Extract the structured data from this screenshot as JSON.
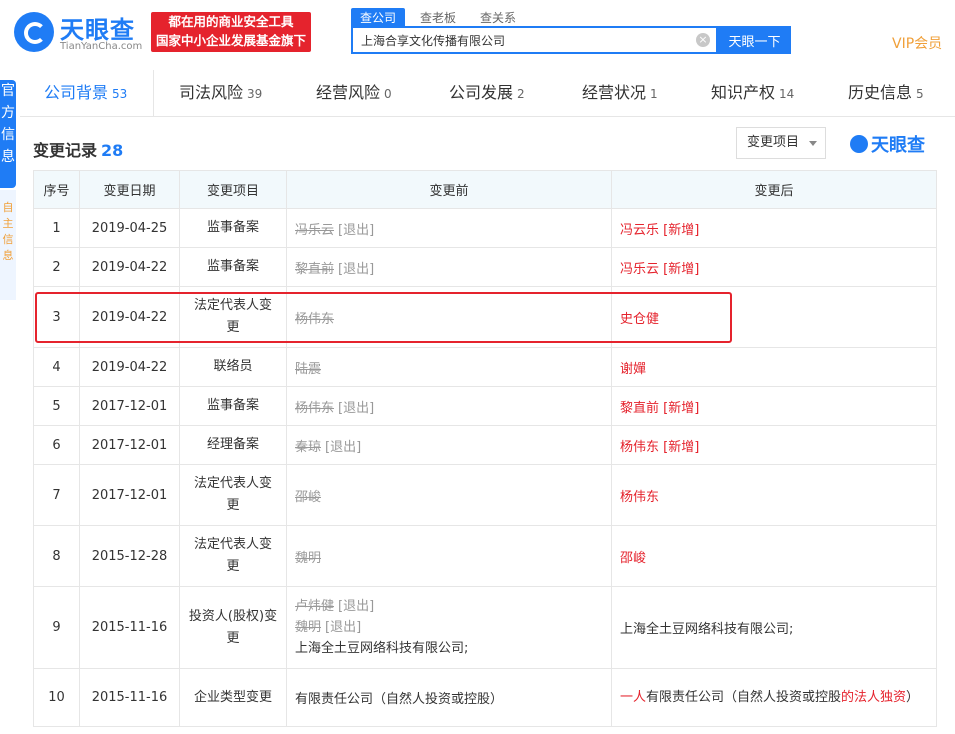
{
  "header": {
    "logo_cn": "天眼查",
    "logo_en": "TianYanCha.com",
    "slogan_line1": "都在用的商业安全工具",
    "slogan_line2": "国家中小企业发展基金旗下",
    "search_tabs": [
      "查公司",
      "查老板",
      "查关系"
    ],
    "search_value": "上海合享文化传播有限公司",
    "search_button": "天眼一下",
    "vip": "VIP会员"
  },
  "left_strip": {
    "blue_text": "官方信息",
    "light_text": "自主信息"
  },
  "nav": {
    "tabs": [
      {
        "label": "公司背景",
        "count": "53"
      },
      {
        "label": "司法风险",
        "count": "39"
      },
      {
        "label": "经营风险",
        "count": "0"
      },
      {
        "label": "公司发展",
        "count": "2"
      },
      {
        "label": "经营状况",
        "count": "1"
      },
      {
        "label": "知识产权",
        "count": "14"
      },
      {
        "label": "历史信息",
        "count": "5"
      }
    ]
  },
  "section": {
    "title": "变更记录",
    "count": "28",
    "filter_label": "变更项目",
    "watermark": "天眼查"
  },
  "table": {
    "headers": [
      "序号",
      "变更日期",
      "变更项目",
      "变更前",
      "变更后"
    ],
    "rows": [
      {
        "idx": "1",
        "date": "2019-04-25",
        "item": "监事备案",
        "before": [
          {
            "name": "冯乐云",
            "tag": "[退出]"
          }
        ],
        "after": [
          {
            "text": "冯云乐 [新增]"
          }
        ]
      },
      {
        "idx": "2",
        "date": "2019-04-22",
        "item": "监事备案",
        "before": [
          {
            "name": "黎直前",
            "tag": "[退出]"
          }
        ],
        "after": [
          {
            "text": "冯乐云 [新增]"
          }
        ]
      },
      {
        "idx": "3",
        "date": "2019-04-22",
        "item": "法定代表人变更",
        "before": [
          {
            "name": "杨伟东",
            "tag": ""
          }
        ],
        "after": [
          {
            "text": "史仓健"
          }
        ]
      },
      {
        "idx": "4",
        "date": "2019-04-22",
        "item": "联络员",
        "before": [
          {
            "name": "陆震",
            "tag": ""
          }
        ],
        "after": [
          {
            "text": "谢嬋"
          }
        ]
      },
      {
        "idx": "5",
        "date": "2017-12-01",
        "item": "监事备案",
        "before": [
          {
            "name": "杨伟东",
            "tag": "[退出]"
          }
        ],
        "after": [
          {
            "text": "黎直前 [新增]"
          }
        ]
      },
      {
        "idx": "6",
        "date": "2017-12-01",
        "item": "经理备案",
        "before": [
          {
            "name": "秦琼",
            "tag": "[退出]"
          }
        ],
        "after": [
          {
            "text": "杨伟东 [新增]"
          }
        ]
      },
      {
        "idx": "7",
        "date": "2017-12-01",
        "item": "法定代表人变更",
        "before": [
          {
            "name": "邵峻",
            "tag": ""
          }
        ],
        "after": [
          {
            "text": "杨伟东"
          }
        ]
      },
      {
        "idx": "8",
        "date": "2015-12-28",
        "item": "法定代表人变更",
        "before": [
          {
            "name": "魏明",
            "tag": ""
          }
        ],
        "after": [
          {
            "text": "邵峻"
          }
        ]
      },
      {
        "idx": "9",
        "date": "2015-11-16",
        "item": "投资人(股权)变更",
        "before": [
          {
            "name": "卢炜健",
            "tag": "[退出]"
          },
          {
            "name": "魏明",
            "tag": "[退出]"
          },
          {
            "plain": "上海全土豆网络科技有限公司;"
          }
        ],
        "after_plain": "上海全土豆网络科技有限公司;"
      },
      {
        "idx": "10",
        "date": "2015-11-16",
        "item": "企业类型变更",
        "before_plain": "有限责任公司（自然人投资或控股）",
        "after_parts": [
          {
            "text": "一人",
            "red": true
          },
          {
            "text": "有限责任公司（自然人投资或控股",
            "red": false
          },
          {
            "text": "的法人独资",
            "red": true
          },
          {
            "text": "）",
            "red": false
          }
        ]
      }
    ]
  },
  "colors": {
    "brand_blue": "#1f7cf5",
    "red": "#e5232d",
    "vip_orange": "#f0a03a",
    "header_bg": "#f2f9fc"
  }
}
